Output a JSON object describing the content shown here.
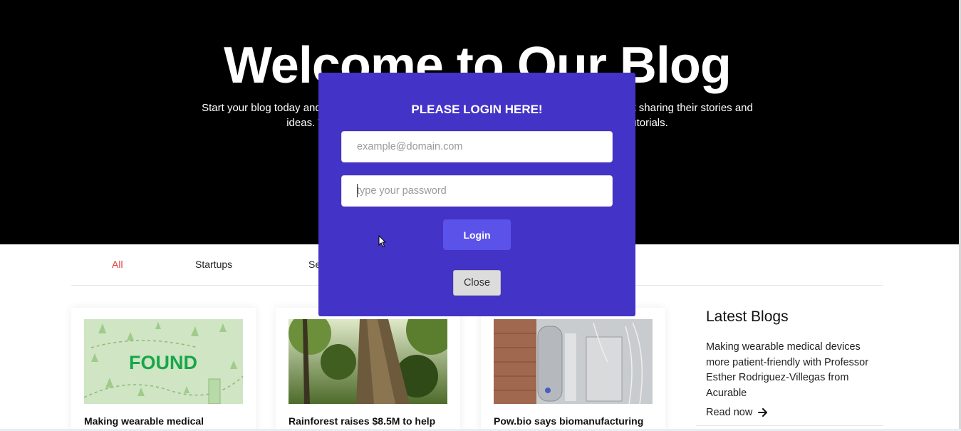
{
  "hero": {
    "title": "Welcome to Our Blog",
    "subtitle": "Start your blog today and join a community of writers and readers who are passionate about sharing their stories and ideas. We offer everything you need to get started, from helpful tips and tutorials."
  },
  "tabs": [
    {
      "label": "All",
      "active": true
    },
    {
      "label": "Startups",
      "active": false
    },
    {
      "label": "Se",
      "active": false
    }
  ],
  "cards": [
    {
      "title": "Making wearable medical",
      "image": "found-illustration",
      "image_text": "FOUND"
    },
    {
      "title": "Rainforest raises $8.5M to help",
      "image": "rainforest-photo"
    },
    {
      "title": "Pow.bio says biomanufacturing",
      "image": "bioreactor-photo"
    }
  ],
  "latest": {
    "heading": "Latest Blogs",
    "text": "Making wearable medical devices more patient-friendly with Professor Esther Rodriguez-Villegas from Acurable",
    "read_more": "Read now",
    "read_more_icon": "arrow-right-icon"
  },
  "modal": {
    "title": "PLEASE LOGIN HERE!",
    "email_placeholder": "example@domain.com",
    "email_value": "",
    "password_placeholder": "type your password",
    "password_value": "",
    "login_label": "Login",
    "close_label": "Close"
  },
  "colors": {
    "hero_bg": "#000000",
    "modal_bg": "#4433c7",
    "login_button": "#5b52ea",
    "active_tab": "#e53935"
  }
}
